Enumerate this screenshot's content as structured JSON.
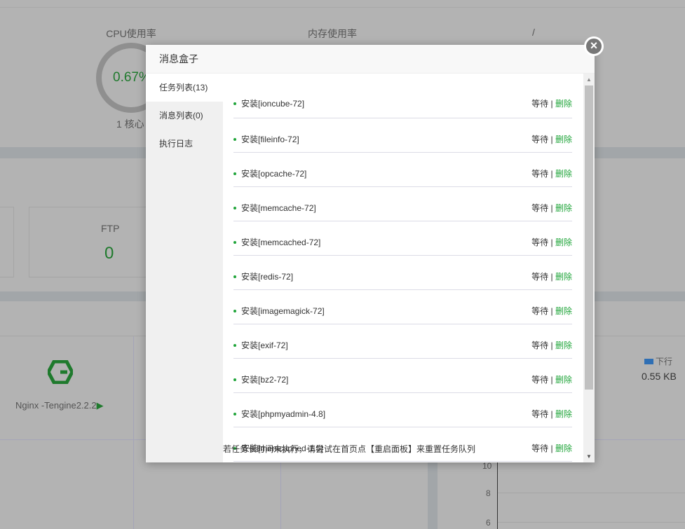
{
  "background": {
    "cpu": {
      "title": "CPU使用率",
      "value": "0.67%",
      "cores": "1 核心"
    },
    "memory": {
      "title": "内存使用率"
    },
    "disk": {
      "title": "/"
    },
    "ftp": {
      "label": "FTP",
      "value": "0"
    },
    "software": {
      "name": "Nginx -Tengine2.2.2"
    },
    "network": {
      "legend": "下行",
      "value": "0.55 KB"
    },
    "y_ticks": [
      "10",
      "8",
      "6"
    ]
  },
  "modal": {
    "title": "消息盒子",
    "tabs": [
      {
        "label": "任务列表(13)",
        "active": true
      },
      {
        "label": "消息列表(0)"
      },
      {
        "label": "执行日志"
      }
    ],
    "status_label": "等待",
    "separator": "|",
    "delete_label": "删除",
    "tasks": [
      "安装[ioncube-72]",
      "安装[fileinfo-72]",
      "安装[opcache-72]",
      "安装[memcache-72]",
      "安装[memcached-72]",
      "安装[redis-72]",
      "安装[imagemagick-72]",
      "安装[exif-72]",
      "安装[bz2-72]",
      "安装[phpmyadmin-4.8]",
      "安装[memcached-1.5]"
    ],
    "footer_note": "若任务长时间未执行，请尝试在首页点【重启面板】来重置任务队列",
    "close_label": "×"
  },
  "colors": {
    "accent": "#20a53a",
    "overlay": "#b3b3b3"
  }
}
